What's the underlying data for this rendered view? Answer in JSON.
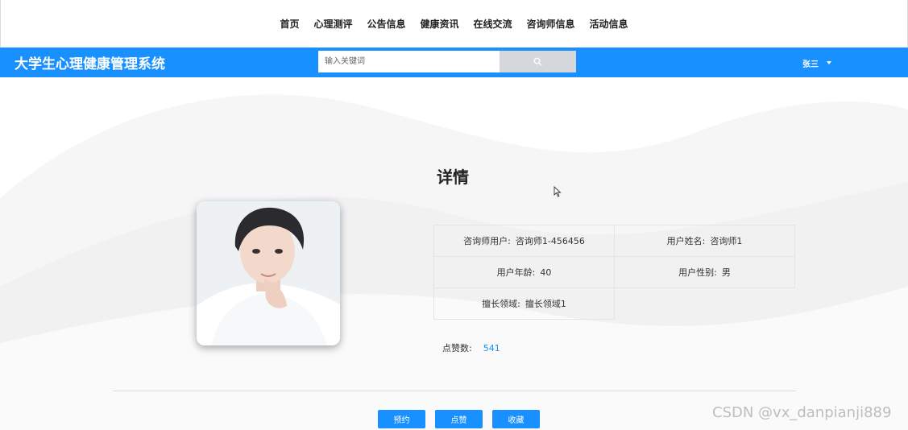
{
  "nav": {
    "items": [
      "首页",
      "心理测评",
      "公告信息",
      "健康资讯",
      "在线交流",
      "咨询师信息",
      "活动信息"
    ]
  },
  "header": {
    "brand": "大学生心理健康管理系统",
    "search_placeholder": "输入关键词",
    "search_icon": "search-icon",
    "user_name": "张三",
    "user_menu_icon": "caret-down-icon"
  },
  "detail": {
    "title": "详情",
    "fields": {
      "counselor_user_label": "咨询师用户:",
      "counselor_user_value": "咨询师1-456456",
      "user_name_label": "用户姓名:",
      "user_name_value": "咨询师1",
      "age_label": "用户年龄:",
      "age_value": "40",
      "gender_label": "用户性别:",
      "gender_value": "男",
      "specialty_label": "擅长领域:",
      "specialty_value": "擅长领域1"
    },
    "likes_label": "点赞数:",
    "likes_value": "541"
  },
  "actions": {
    "book": "预约",
    "like": "点赞",
    "favorite": "收藏"
  },
  "watermark": "CSDN @vx_danpianji889",
  "colors": {
    "primary": "#1890ff",
    "search_button": "#d4d7dc"
  }
}
